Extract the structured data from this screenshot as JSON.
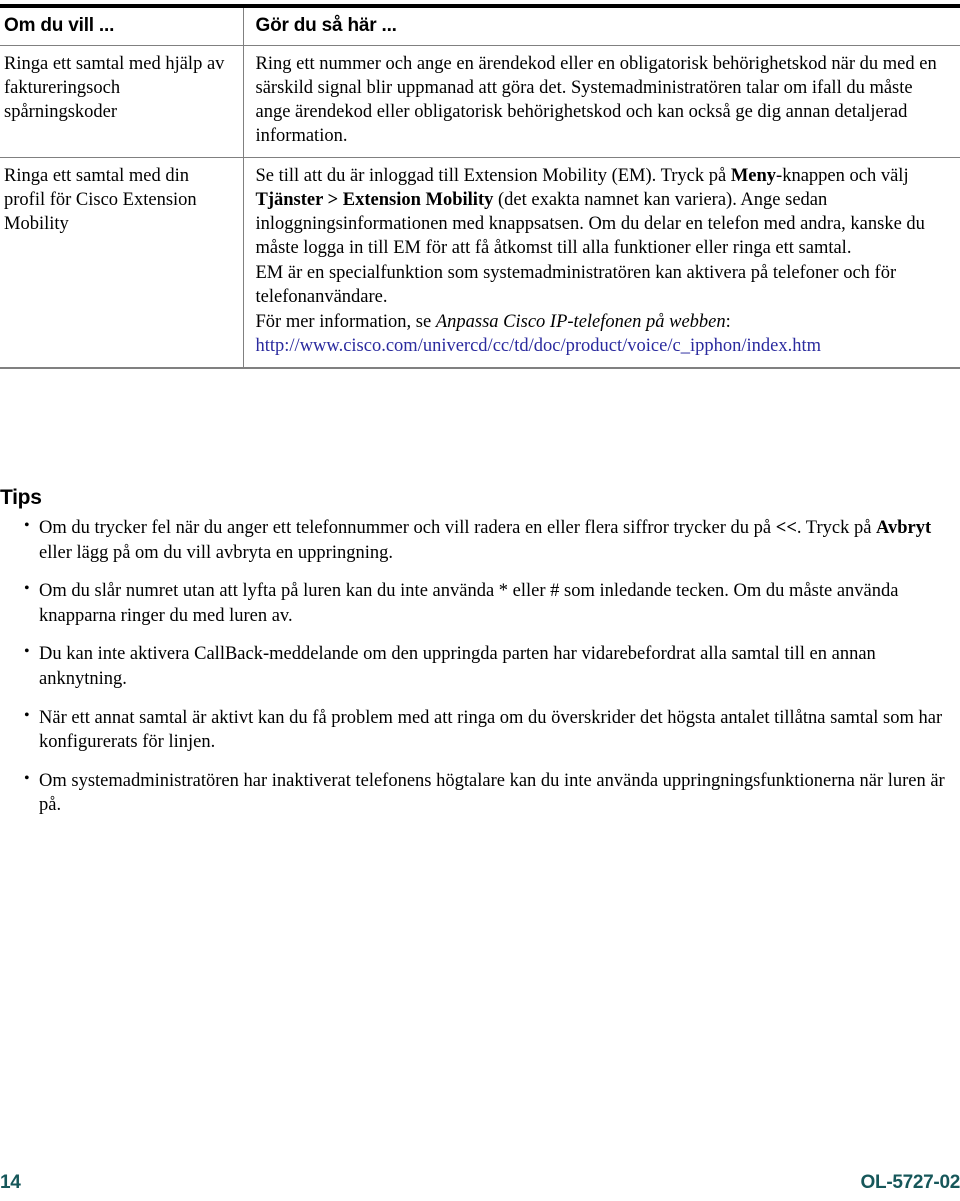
{
  "table": {
    "headers": {
      "col1": "Om du vill ...",
      "col2": "Gör du så här ..."
    },
    "rows": [
      {
        "task": "Ringa ett samtal med hjälp av faktureringsoch spårningskoder",
        "task_line1": "Ringa ett samtal med",
        "task_line2": "hjälp av faktureringsoch",
        "steps": [
          "Ring ett nummer och ange en ärendekod eller en obligatorisk behörighetskod när du med en särskild signal blir uppmanad att göra det. Systemadministratören talar om ifall du måste ange ärendekod eller obligatorisk behörighetskod och kan också ge dig annan detaljerad information."
        ]
      },
      {
        "task": "Ringa ett samtal med din profil för Cisco Extension Mobility",
        "steps_rich": {
          "p1_a": "Se till att du är inloggad till Extension Mobility (EM). Tryck på ",
          "p1_b": "Meny",
          "p1_c": "-knappen och välj ",
          "p1_d": "Tjänster > Extension Mobility",
          "p1_e": " (det exakta namnet kan variera). Ange sedan inloggningsinformationen med knappsatsen. Om du delar en telefon med andra, kanske du måste logga in till EM för att få åtkomst till alla funktioner eller ringa ett samtal.",
          "p2": "EM är en specialfunktion som systemadministratören kan aktivera på telefoner och för telefonanvändare.",
          "p3_a": "För mer information, se ",
          "p3_b": "Anpassa Cisco IP-telefonen på webben",
          "p3_c": ":",
          "link": "http://www.cisco.com/univercd/cc/td/doc/product/voice/c_ipphon/index.htm"
        }
      }
    ]
  },
  "tips": {
    "heading": "Tips",
    "items": [
      {
        "a": "Om du trycker fel när du anger ett telefonnummer och vill radera en eller flera siffror trycker du på ",
        "b1": "<<",
        "c": ". Tryck på ",
        "b2": "Avbryt",
        "d": " eller lägg på om du vill avbryta en uppringning.",
        "bullet": "•"
      },
      {
        "a": "Om du slår numret utan att lyfta på luren kan du inte använda * eller # som inledande tecken. Om du måste använda knapparna ringer du med luren av.",
        "bullet": "•"
      },
      {
        "a": "Du kan inte aktivera CallBack-meddelande om den uppringda parten har vidarebefordrat alla samtal till en annan anknytning.",
        "bullet": "•"
      },
      {
        "a": "När ett annat samtal är aktivt kan du få problem med att ringa om du överskrider det högsta antalet tillåtna samtal som har konfigurerats för linjen.",
        "bullet": "•"
      },
      {
        "a": "Om systemadministratören har inaktiverat telefonens högtalare kan du inte använda uppringningsfunktionerna när luren är på.",
        "bullet": "•"
      }
    ]
  },
  "footer": {
    "page_number": "14",
    "document_id": "OL-5727-02"
  },
  "colors": {
    "link": "#2a2a9e",
    "footer": "#16575a",
    "rule": "#808080",
    "text": "#000000"
  }
}
